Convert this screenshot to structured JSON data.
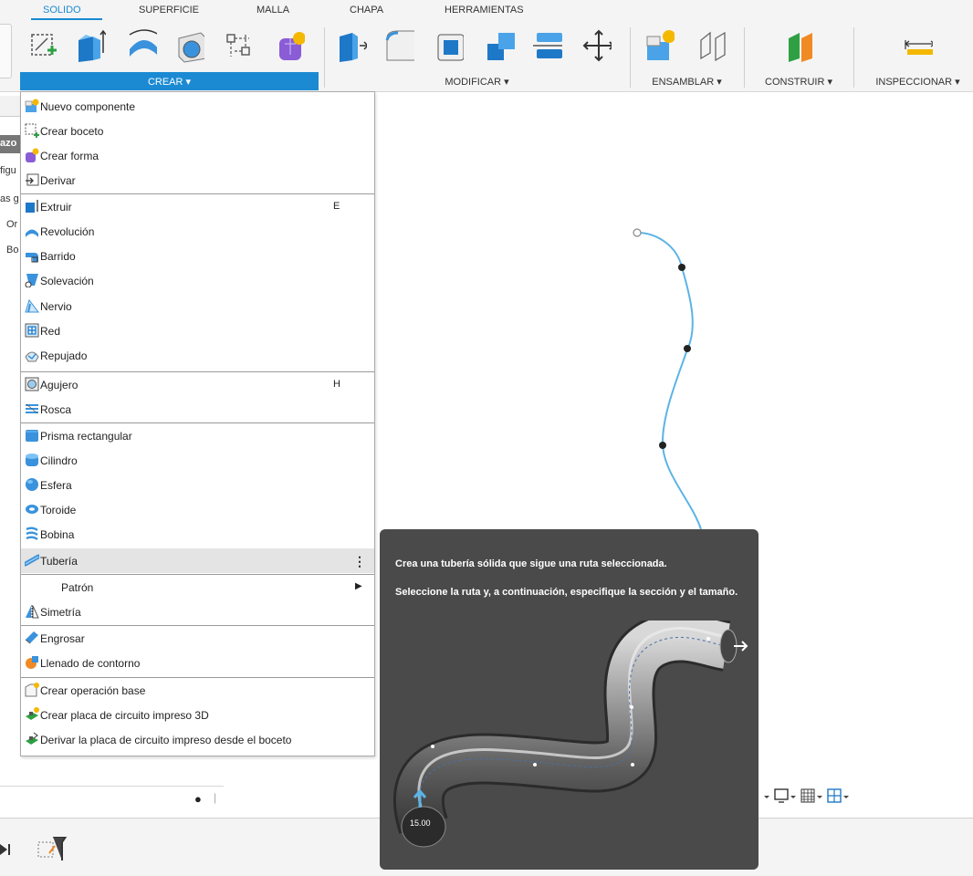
{
  "ribbon": {
    "tabs": [
      {
        "label": "SOLIDO",
        "active": true
      },
      {
        "label": "SUPERFICIE"
      },
      {
        "label": "MALLA"
      },
      {
        "label": "CHAPA"
      },
      {
        "label": "HERRAMIENTAS"
      }
    ],
    "groups": {
      "crear": "CREAR ▾",
      "modificar": "MODIFICAR ▾",
      "ensamblar": "ENSAMBLAR ▾",
      "construir": "CONSTRUIR ▾",
      "inspeccionar": "INSPECCIONAR ▾"
    },
    "accent_color": "#1b8ad3"
  },
  "left_panel": {
    "items": [
      "azo",
      "figu",
      "as g",
      "Or",
      "Bo"
    ]
  },
  "menu": {
    "items": [
      {
        "label": "Nuevo componente",
        "icon": "new-component-icon"
      },
      {
        "label": "Crear boceto",
        "icon": "create-sketch-icon"
      },
      {
        "label": "Crear forma",
        "icon": "create-form-icon"
      },
      {
        "label": "Derivar",
        "icon": "derive-icon"
      },
      {
        "label": "Extruir",
        "icon": "extrude-icon",
        "shortcut": "E"
      },
      {
        "label": "Revolución",
        "icon": "revolve-icon"
      },
      {
        "label": "Barrido",
        "icon": "sweep-icon"
      },
      {
        "label": "Solevación",
        "icon": "loft-icon"
      },
      {
        "label": "Nervio",
        "icon": "rib-icon"
      },
      {
        "label": "Red",
        "icon": "web-icon"
      },
      {
        "label": "Repujado",
        "icon": "emboss-icon"
      },
      {
        "label": "Agujero",
        "icon": "hole-icon",
        "shortcut": "H"
      },
      {
        "label": "Rosca",
        "icon": "thread-icon"
      },
      {
        "label": "Prisma rectangular",
        "icon": "box-icon"
      },
      {
        "label": "Cilindro",
        "icon": "cylinder-icon"
      },
      {
        "label": "Esfera",
        "icon": "sphere-icon"
      },
      {
        "label": "Toroide",
        "icon": "torus-icon"
      },
      {
        "label": "Bobina",
        "icon": "coil-icon"
      },
      {
        "label": "Tubería",
        "icon": "pipe-icon",
        "more": "⋮"
      },
      {
        "label": "Patrón",
        "submenu": "▶"
      },
      {
        "label": "Simetría",
        "icon": "mirror-icon"
      },
      {
        "label": "Engrosar",
        "icon": "thicken-icon"
      },
      {
        "label": "Llenado de contorno",
        "icon": "boundary-fill-icon"
      },
      {
        "label": "Crear operación base",
        "icon": "base-feature-icon"
      },
      {
        "label": "Crear placa de circuito impreso 3D",
        "icon": "pcb-3d-icon"
      },
      {
        "label": "Derivar la placa de circuito impreso desde el boceto",
        "icon": "pcb-derive-icon"
      }
    ]
  },
  "tooltip": {
    "line1": "Crea una tubería sólida que sigue una ruta seleccionada.",
    "line2": "Seleccione la ruta y, a continuación, especifique la sección y el tamaño.",
    "dimension": "15.00"
  }
}
